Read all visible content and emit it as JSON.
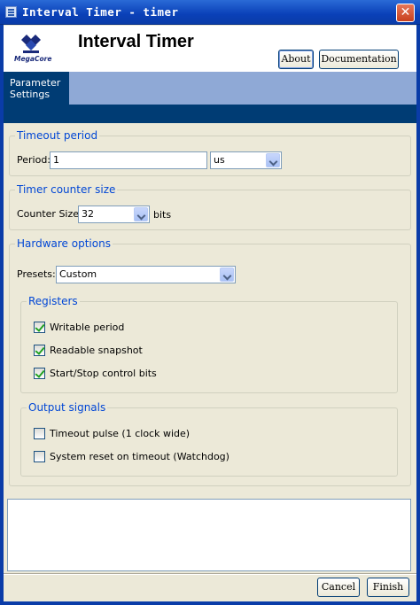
{
  "window": {
    "title": "Interval Timer - timer",
    "close_label": "✕"
  },
  "header": {
    "logo_text": "MegaCore",
    "app_title": "Interval Timer",
    "about_label": "About",
    "documentation_label": "Documentation"
  },
  "tabs": [
    {
      "label": "Parameter Settings",
      "active": true
    }
  ],
  "timeout_period": {
    "legend": "Timeout period",
    "period_label": "Period:",
    "period_value": "1",
    "unit_value": "us"
  },
  "timer_counter_size": {
    "legend": "Timer counter size",
    "label": "Counter Size:",
    "value": "32",
    "unit": "bits"
  },
  "hardware_options": {
    "legend": "Hardware options",
    "presets_label": "Presets:",
    "presets_value": "Custom",
    "registers": {
      "legend": "Registers",
      "items": [
        {
          "label": "Writable period",
          "checked": true
        },
        {
          "label": "Readable snapshot",
          "checked": true
        },
        {
          "label": "Start/Stop control bits",
          "checked": true
        }
      ]
    },
    "output_signals": {
      "legend": "Output signals",
      "items": [
        {
          "label": "Timeout pulse (1 clock wide)",
          "checked": false
        },
        {
          "label": "System reset on timeout (Watchdog)",
          "checked": false
        }
      ]
    }
  },
  "footer": {
    "cancel_label": "Cancel",
    "finish_label": "Finish"
  },
  "colors": {
    "title_bar": "#0a40b8",
    "legend_text": "#0046d5",
    "tab_active": "#003c74",
    "tab_strip": "#8fa9d6"
  }
}
